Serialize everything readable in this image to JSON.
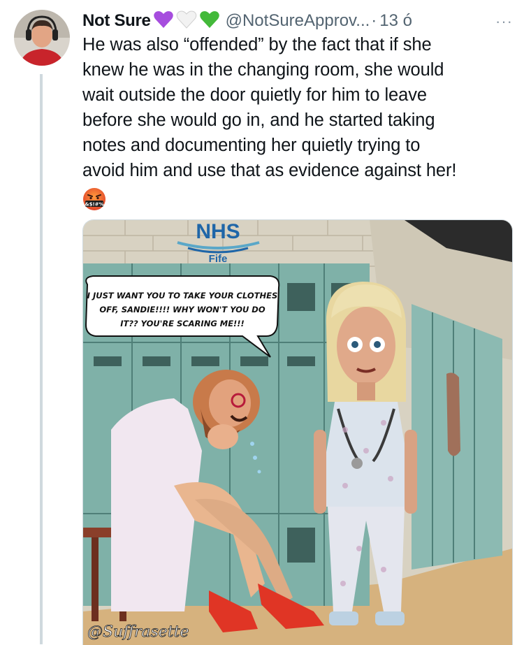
{
  "tweet": {
    "author_name": "Not Sure",
    "author_handle": "@NotSureApprov...",
    "separator": "·",
    "time": "13 ó",
    "more_label": "···",
    "lines": [
      "He was also “offended” by the fact that if she",
      "knew he was in the changing room, she would",
      "wait outside the door quietly for him to leave",
      "before she would go in, and he started taking",
      "notes and documenting her quietly trying to",
      "avoid him and use that as evidence against her!"
    ],
    "emoji_text": "&$!#%",
    "badges": [
      "purple-heart-icon",
      "white-heart-icon",
      "green-heart-icon"
    ]
  },
  "media": {
    "logo_text": "NHS",
    "logo_subtext": "Fife",
    "speech_lines": [
      "I JUST WANT YOU TO TAKE YOUR CLOTHES",
      "OFF, SANDIE!!!! WHY WON'T YOU DO",
      "IT?? YOU'RE SCARING ME!!!"
    ],
    "signature": "@Suffrasette"
  },
  "colors": {
    "purple_heart": "#a64dde",
    "white_heart": "#f0f0f0",
    "green_heart": "#43b93a",
    "nhs_blue": "#1f66a8",
    "locker": "#7fb1a8",
    "shoe_red": "#e03525"
  }
}
